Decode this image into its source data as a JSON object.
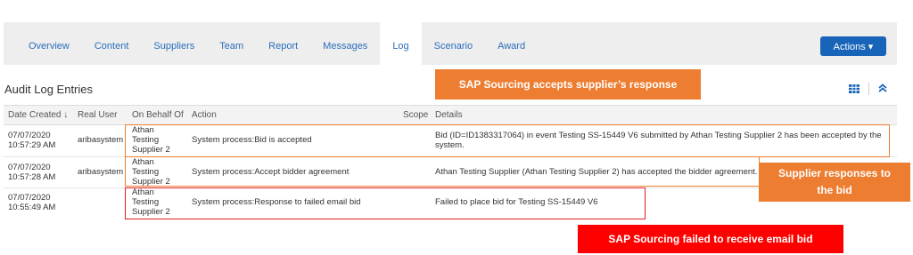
{
  "tabs": [
    {
      "label": "Overview"
    },
    {
      "label": "Content"
    },
    {
      "label": "Suppliers"
    },
    {
      "label": "Team"
    },
    {
      "label": "Report"
    },
    {
      "label": "Messages"
    },
    {
      "label": "Log"
    },
    {
      "label": "Scenario"
    },
    {
      "label": "Award"
    }
  ],
  "actions_label": "Actions ▾",
  "page_title": "Audit Log Entries",
  "annotations": {
    "accepts": "SAP Sourcing accepts supplier’s response",
    "supplier_line1": "Supplier responses to",
    "supplier_line2": "the bid",
    "failed": "SAP Sourcing failed to receive email bid"
  },
  "table": {
    "headers": {
      "date": "Date Created ↓",
      "user": "Real User",
      "behalf": "On Behalf Of",
      "action": "Action",
      "scope": "Scope",
      "details": "Details"
    },
    "rows": [
      {
        "date": "07/07/2020",
        "time": "10:57:29 AM",
        "user": "aribasystem",
        "behalf1": "Athan",
        "behalf2": "Testing",
        "behalf3": "Supplier 2",
        "action": "System process:Bid is accepted",
        "details1": "Bid (ID=ID1383317064) in event Testing SS-15449 V6 submitted by Athan Testing Supplier 2 has been accepted by the",
        "details2": "system."
      },
      {
        "date": "07/07/2020",
        "time": "10:57:28 AM",
        "user": "aribasystem",
        "behalf1": "Athan",
        "behalf2": "Testing",
        "behalf3": "Supplier 2",
        "action": "System process:Accept bidder agreement",
        "details1": "Athan Testing Supplier (Athan Testing Supplier 2) has accepted the bidder agreement.",
        "details2": ""
      },
      {
        "date": "07/07/2020",
        "time": "10:55:49 AM",
        "user": "",
        "behalf1": "Athan",
        "behalf2": "Testing",
        "behalf3": "Supplier 2",
        "action": "System process:Response to failed email bid",
        "details1": "Failed to place bid for Testing SS-15449 V6",
        "details2": ""
      }
    ]
  },
  "colors": {
    "accent": "#1764b8",
    "tab_text": "#2a6ebb",
    "callout_orange": "#ed7d31",
    "callout_red": "#ff0000"
  },
  "icons": [
    "grid-view-icon",
    "collapse-up-icon"
  ]
}
